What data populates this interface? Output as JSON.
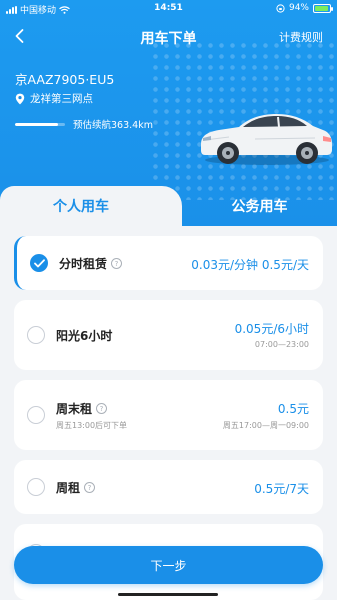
{
  "status_bar": {
    "carrier": "中国移动",
    "time": "14:51",
    "battery": "94%",
    "battery_level": 0.94
  },
  "nav": {
    "title": "用车下单",
    "right_link": "计费规则"
  },
  "vehicle": {
    "plate": "京AAZ7905·EU5",
    "station": "龙祥第三网点",
    "range_label": "预估续航363.4km",
    "range_level": 0.85
  },
  "tabs": [
    {
      "label": "个人用车",
      "active": true
    },
    {
      "label": "公务用车",
      "active": false
    }
  ],
  "plans": [
    {
      "name": "分时租赁",
      "price": "0.03元/分钟 0.5元/天",
      "sub": "",
      "hours": "",
      "selected": true
    },
    {
      "name": "阳光6小时",
      "price": "0.05元/6小时",
      "sub": "",
      "hours": "07:00—23:00",
      "selected": false
    },
    {
      "name": "周末租",
      "price": "0.5元",
      "sub": "周五13:00后可下单",
      "hours": "周五17:00—周一09:00",
      "selected": false
    },
    {
      "name": "周租",
      "price": "0.5元/7天",
      "sub": "",
      "hours": "",
      "selected": false
    }
  ],
  "next_button": "下一步",
  "colors": {
    "accent": "#1a8fe8",
    "background": "#f2f4f7"
  }
}
